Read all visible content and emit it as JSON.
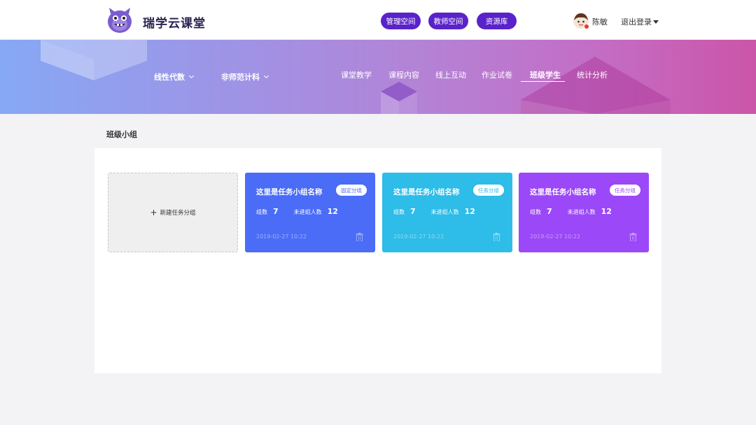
{
  "header": {
    "brand": "瑞学云课堂",
    "nav_buttons": [
      "管理空间",
      "教师空间",
      "资源库"
    ],
    "username": "陈敏",
    "logout": "退出登录"
  },
  "banner": {
    "selectors": [
      "线性代数",
      "非师范计科"
    ],
    "tabs": [
      "课堂教学",
      "课程内容",
      "线上互动",
      "作业试卷",
      "班级学生",
      "统计分析"
    ],
    "active_tab": "班级学生"
  },
  "section": {
    "title": "班级小组",
    "new_group_label": "新建任务分组"
  },
  "groups": [
    {
      "name": "这里是任务小组名称",
      "badge": "固定分组",
      "members_label": "组数",
      "members": "7",
      "pending_label": "未进组人数",
      "pending": "12",
      "date": "2019-02-27  10:22",
      "color": "#4a6cf7"
    },
    {
      "name": "这里是任务小组名称",
      "badge": "任务分组",
      "members_label": "组数",
      "members": "7",
      "pending_label": "未进组人数",
      "pending": "12",
      "date": "2019-02-27  10:22",
      "color": "#2ebce8"
    },
    {
      "name": "这里是任务小组名称",
      "badge": "任务分组",
      "members_label": "组数",
      "members": "7",
      "pending_label": "未进组人数",
      "pending": "12",
      "date": "2019-02-27  10:22",
      "color": "#9b48f8"
    }
  ],
  "colors": {
    "nav_purple": "#5a22c9",
    "banner_start": "#86a8f5",
    "banner_end": "#cb55a8"
  }
}
